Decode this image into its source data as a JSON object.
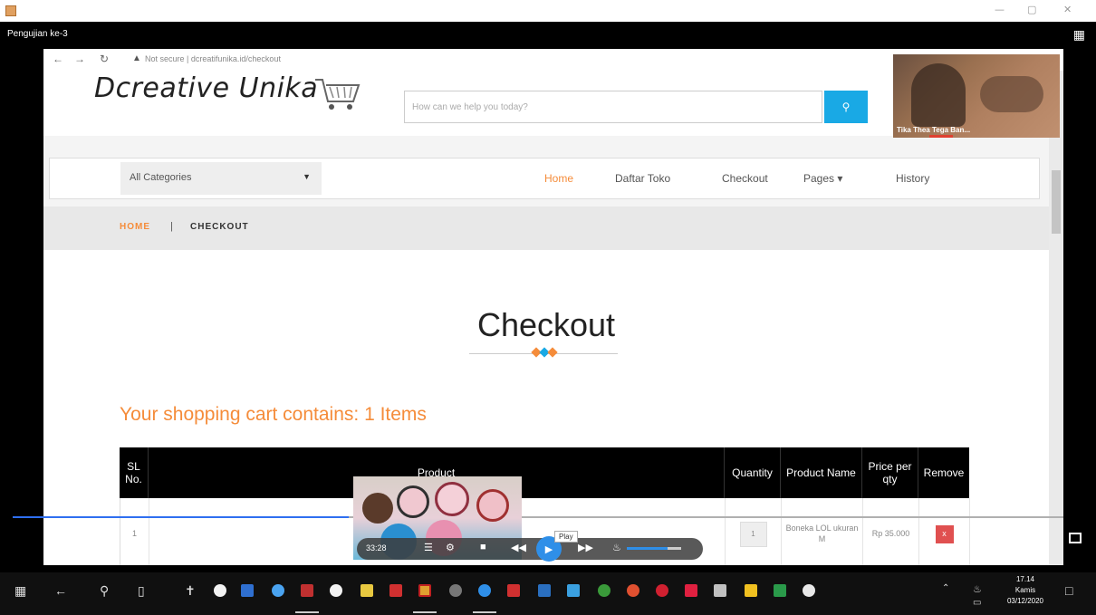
{
  "meeting": {
    "title": "Pengujian ke-3",
    "participant_name": "Tika Thea Tega Ban..."
  },
  "browser": {
    "security": "Not secure",
    "url": "dcreatifunika.id/checkout"
  },
  "site": {
    "logo": "Dcreative Unika",
    "search_placeholder": "How can we help you today?",
    "category_select": "All Categories",
    "nav": [
      "Home",
      "Daftar Toko",
      "Checkout",
      "Pages ▾",
      "History"
    ],
    "active_nav": "Home",
    "accent_color": "#f58c3a",
    "search_button_color": "#19a9e5"
  },
  "breadcrumb": {
    "home": "HOME",
    "separator": "|",
    "current": "CHECKOUT"
  },
  "checkout": {
    "heading": "Checkout",
    "cart_summary": "Your shopping cart contains: 1 Items",
    "columns": [
      "SL No.",
      "Product",
      "Quantity",
      "Product Name",
      "Price per qty",
      "Remove"
    ],
    "rows": [
      {
        "sl": "1",
        "quantity": "1",
        "product_name": "Boneka LOL ukuran M",
        "price": "Rp 35.000",
        "remove": "x"
      }
    ]
  },
  "player": {
    "time": "33:28",
    "play_tooltip": "Play",
    "progress_fraction": 0.32,
    "volume_fraction": 0.75
  },
  "taskbar": {
    "clock_time": "17.14",
    "clock_day": "Kamis",
    "clock_date": "03/12/2020"
  }
}
